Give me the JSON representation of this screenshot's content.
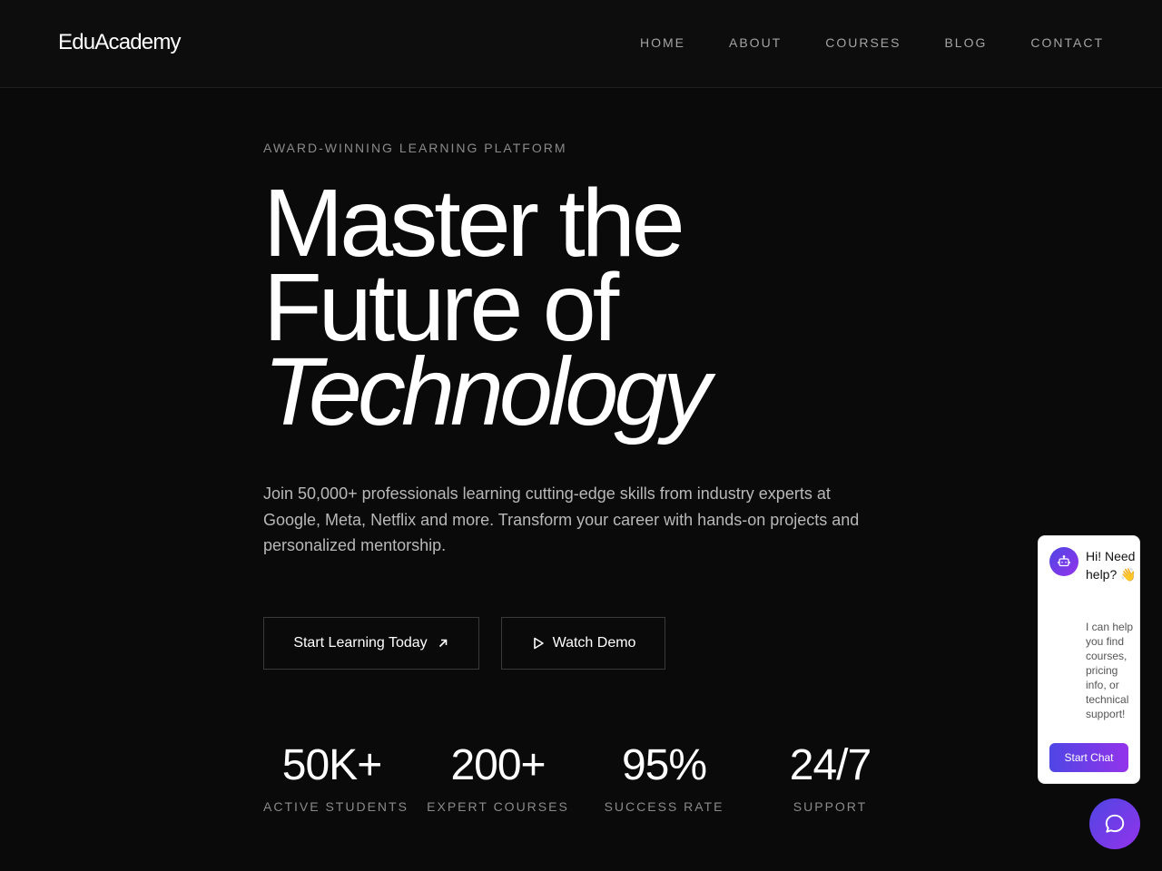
{
  "brand": {
    "logo": "EduAcademy"
  },
  "nav": [
    {
      "label": "HOME"
    },
    {
      "label": "ABOUT"
    },
    {
      "label": "COURSES"
    },
    {
      "label": "BLOG"
    },
    {
      "label": "CONTACT"
    }
  ],
  "hero": {
    "eyebrow": "AWARD-WINNING LEARNING PLATFORM",
    "headline_line1": "Master the",
    "headline_line2": "Future of",
    "headline_line3": "Technology",
    "lead": "Join 50,000+ professionals learning cutting-edge skills from industry experts at Google, Meta, Netflix and more. Transform your career with hands-on projects and personalized mentorship.",
    "primary_cta": {
      "label": "Start Learning Today",
      "icon": "arrow-up-right-icon"
    },
    "secondary_cta": {
      "label": "Watch Demo",
      "icon": "play-icon"
    }
  },
  "stats": [
    {
      "value": "50K+",
      "label": "ACTIVE STUDENTS"
    },
    {
      "value": "200+",
      "label": "EXPERT COURSES"
    },
    {
      "value": "95%",
      "label": "SUCCESS RATE"
    },
    {
      "value": "24/7",
      "label": "SUPPORT"
    }
  ],
  "chat_widget": {
    "title": "Hi! Need help? 👋",
    "body": "I can help you find courses, pricing info, or technical support!",
    "button": "Start Chat",
    "avatar_icon": "robot-icon",
    "launcher_icon": "chat-bubble-icon"
  },
  "colors": {
    "background": "#0a0a0a",
    "accent_gradient_start": "#4f46e5",
    "accent_gradient_end": "#9333ea"
  }
}
